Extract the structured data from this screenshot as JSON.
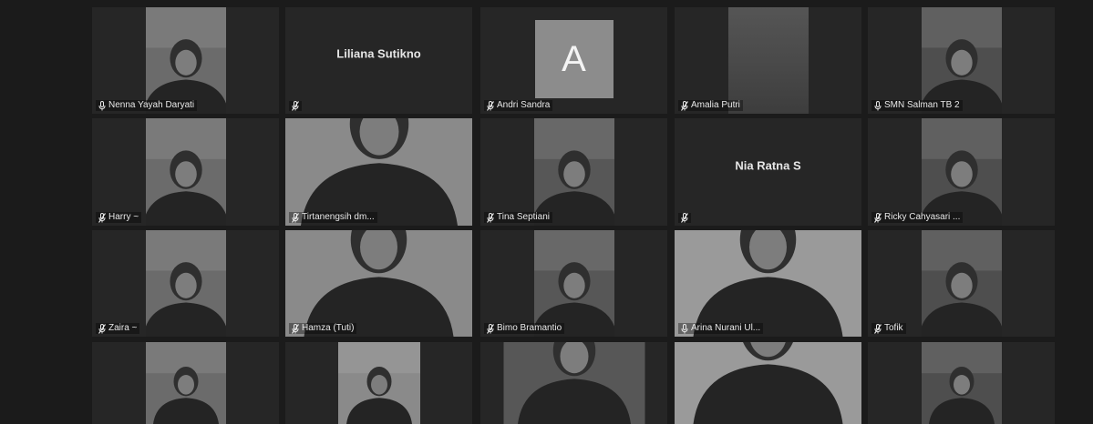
{
  "participants": [
    {
      "name": "Nenna Yayah Daryati",
      "kind": "video",
      "muted": false
    },
    {
      "name": "Liliana Sutikno",
      "kind": "name",
      "muted": true
    },
    {
      "name": "Andri Sandra",
      "kind": "avatar",
      "initial": "A",
      "muted": true
    },
    {
      "name": "Amalia Putri",
      "kind": "blur",
      "muted": true
    },
    {
      "name": "SMN Salman TB 2",
      "kind": "video",
      "muted": false
    },
    {
      "name": "Harry ~",
      "kind": "video",
      "muted": true
    },
    {
      "name": "Tirtanengsih dm...",
      "kind": "video",
      "muted": true,
      "active": true
    },
    {
      "name": "Tina Septiani",
      "kind": "video",
      "muted": true
    },
    {
      "name": "Nia Ratna S",
      "kind": "name",
      "muted": true
    },
    {
      "name": "Ricky Cahyasari ...",
      "kind": "video",
      "muted": true
    },
    {
      "name": "Zaira ~",
      "kind": "video",
      "muted": true
    },
    {
      "name": "Hamza (Tuti)",
      "kind": "video",
      "muted": true
    },
    {
      "name": "Bimo Bramantio",
      "kind": "video",
      "muted": true
    },
    {
      "name": "Arina Nurani Ul...",
      "kind": "video",
      "muted": false
    },
    {
      "name": "Tofik",
      "kind": "video",
      "muted": true
    },
    {
      "name": "",
      "kind": "video",
      "muted": false
    },
    {
      "name": "",
      "kind": "video",
      "muted": false
    },
    {
      "name": "",
      "kind": "video",
      "muted": false
    },
    {
      "name": "",
      "kind": "video",
      "muted": false
    },
    {
      "name": "",
      "kind": "video",
      "muted": false
    }
  ],
  "colors": {
    "background": "#1b1b1b",
    "tile": "#262626",
    "active_border": "#d9d9d9",
    "avatar": "#8c8c8c"
  }
}
